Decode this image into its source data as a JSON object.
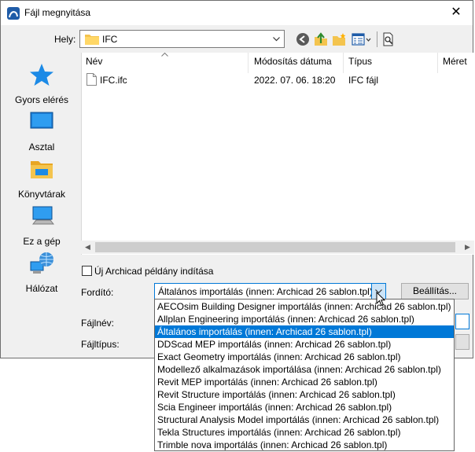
{
  "window": {
    "title": "Fájl megnyitása",
    "close_glyph": "✕"
  },
  "location": {
    "label": "Hely:",
    "value": "IFC"
  },
  "places": [
    {
      "label": "Gyors elérés",
      "icon": "quick-access-star-icon"
    },
    {
      "label": "Asztal",
      "icon": "desktop-icon"
    },
    {
      "label": "Könyvtárak",
      "icon": "libraries-icon"
    },
    {
      "label": "Ez a gép",
      "icon": "this-pc-icon"
    },
    {
      "label": "Hálózat",
      "icon": "network-icon"
    }
  ],
  "columns": {
    "name": "Név",
    "date": "Módosítás dátuma",
    "type": "Típus",
    "size": "Méret"
  },
  "files": [
    {
      "name": "IFC.ifc",
      "date": "2022. 07. 06. 18:20",
      "type": "IFC fájl"
    }
  ],
  "options": {
    "new_instance_label": "Új Archicad példány indítása",
    "new_instance_checked": false
  },
  "translator": {
    "label": "Fordító:",
    "selected": "Általános importálás (innen: Archicad 26 sablon.tpl)",
    "settings_label": "Beállítás...",
    "items": [
      "AECOsim Building Designer importálás (innen: Archicad 26 sablon.tpl)",
      "Allplan Engineering importálás (innen: Archicad 26 sablon.tpl)",
      "Általános importálás (innen: Archicad 26 sablon.tpl)",
      "DDScad MEP importálás (innen: Archicad 26 sablon.tpl)",
      "Exact Geometry importálás (innen: Archicad 26 sablon.tpl)",
      "Modellező alkalmazások importálása (innen: Archicad 26 sablon.tpl)",
      "Revit MEP importálás (innen: Archicad 26 sablon.tpl)",
      "Revit Structure importálás (innen: Archicad 26 sablon.tpl)",
      "Scia Engineer importálás (innen: Archicad 26 sablon.tpl)",
      "Structural Analysis Model importálás (innen: Archicad 26 sablon.tpl)",
      "Tekla Structures importálás (innen: Archicad 26 sablon.tpl)",
      "Trimble nova importálás (innen: Archicad 26 sablon.tpl)"
    ],
    "highlighted_index": 2
  },
  "filename": {
    "label": "Fájlnév:"
  },
  "filetype": {
    "label": "Fájltípus:"
  },
  "colors": {
    "accent": "#0078d7",
    "folder": "#f4c44e"
  }
}
